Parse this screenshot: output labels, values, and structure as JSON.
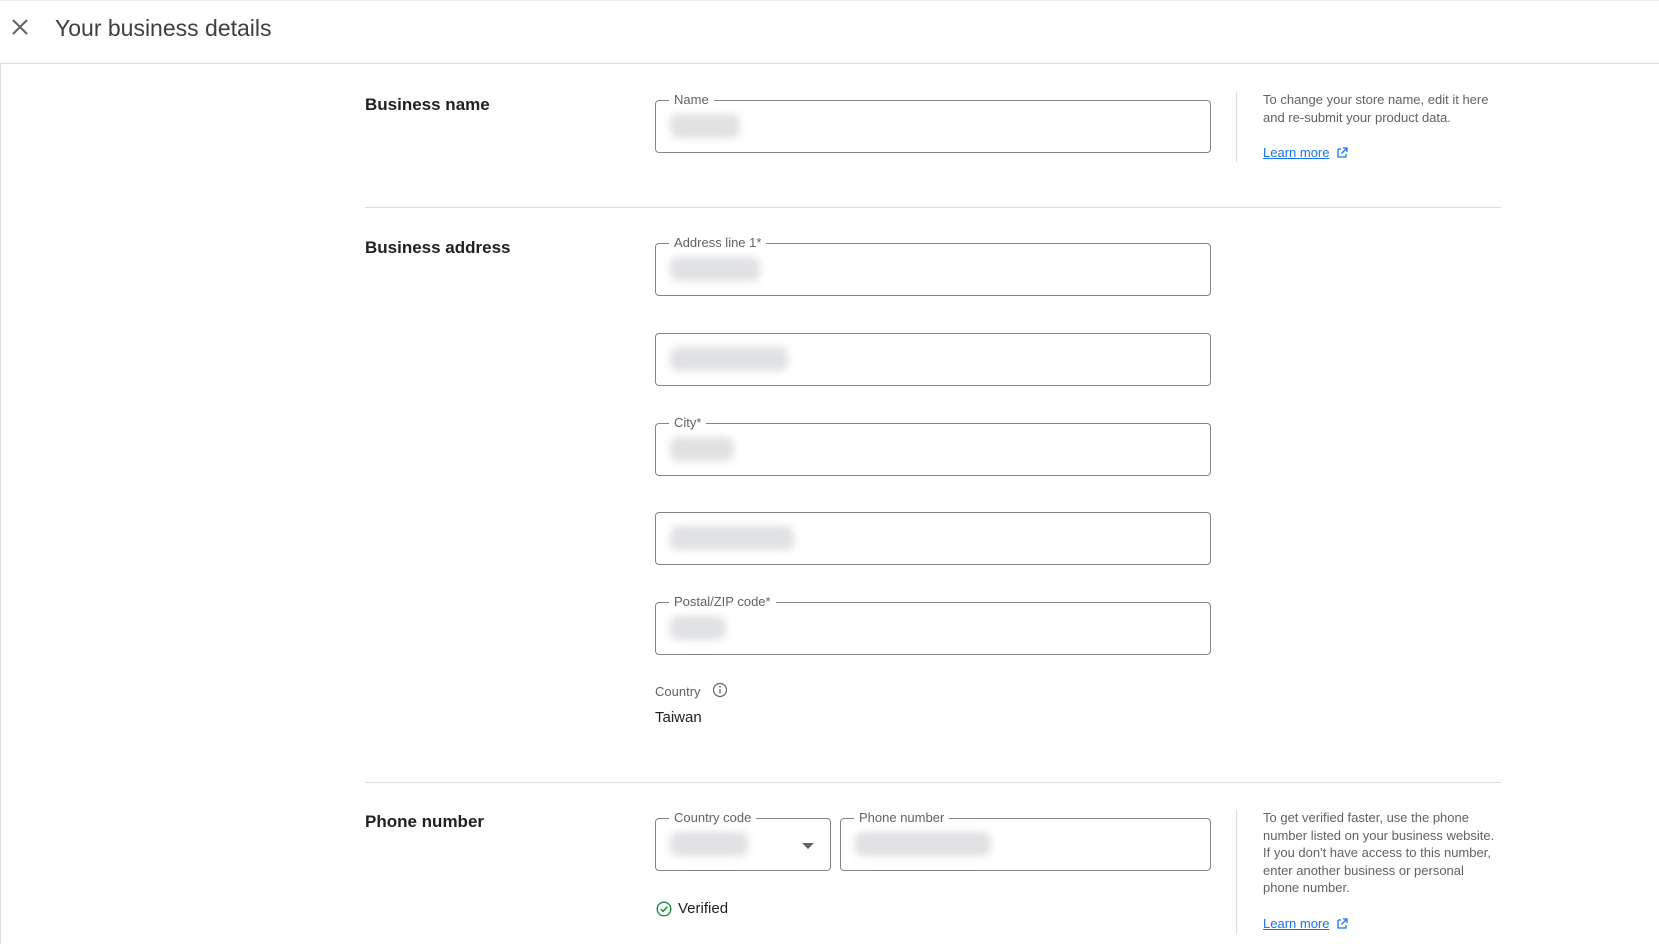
{
  "header": {
    "title": "Your business details",
    "close_icon": "close-icon"
  },
  "business_name": {
    "section_title": "Business name",
    "name_field": {
      "label": "Name",
      "value": ""
    },
    "help_text": "To change your store name, edit it here and re-submit your product data.",
    "learn_more": "Learn more"
  },
  "business_address": {
    "section_title": "Business address",
    "address_line1": {
      "label": "Address line 1*",
      "value": ""
    },
    "address_line2": {
      "value": ""
    },
    "city": {
      "label": "City*",
      "value": ""
    },
    "region": {
      "value": ""
    },
    "postal": {
      "label": "Postal/ZIP code*",
      "value": ""
    },
    "country_label": "Country",
    "country_value": "Taiwan",
    "info_icon": "info-icon"
  },
  "phone": {
    "section_title": "Phone number",
    "country_code": {
      "label": "Country code",
      "value": ""
    },
    "phone_number": {
      "label": "Phone number",
      "value": ""
    },
    "verified": "Verified",
    "help_text": "To get verified faster, use the phone number listed on your business website. If you don't have access to this number, enter another business or personal phone number.",
    "learn_more": "Learn more"
  },
  "colors": {
    "link": "#1a73e8",
    "verified": "#1e8e3e",
    "border": "#80868b",
    "divider": "#dadce0"
  }
}
